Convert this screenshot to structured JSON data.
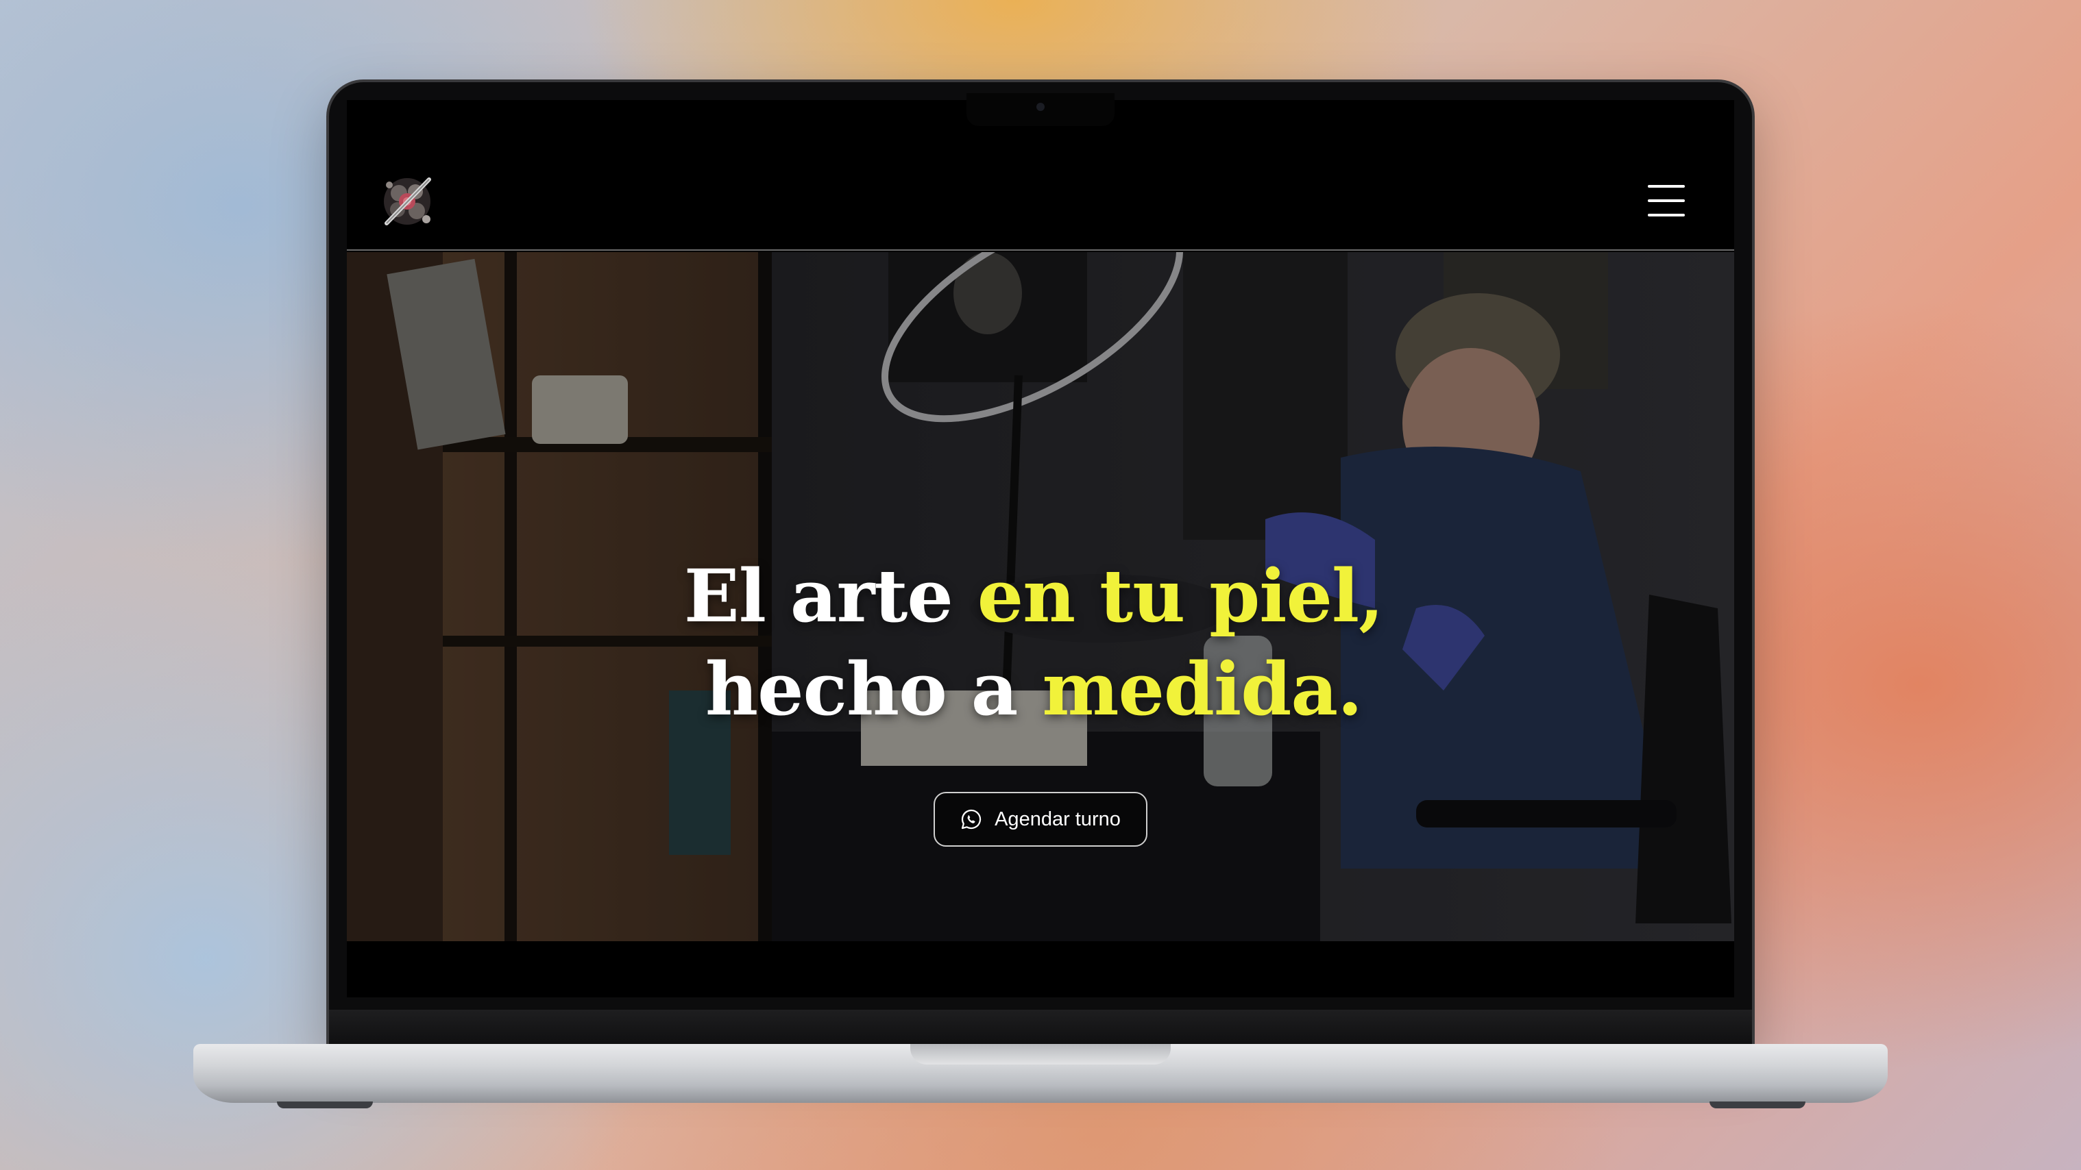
{
  "site": {
    "hero": {
      "headline_line1": {
        "part1": "El arte ",
        "part2": "en tu piel,",
        "part2_color": "#f1f23a"
      },
      "headline_line2": {
        "part1": "hecho a ",
        "part2": "medida.",
        "part2_color": "#f1f23a"
      }
    },
    "cta": {
      "label": "Agendar turno",
      "icon": "whatsapp-icon"
    },
    "header": {
      "logo": "tattoo-logo",
      "menu_icon": "hamburger-menu-icon"
    }
  },
  "colors": {
    "accent": "#f1f23a",
    "text": "#ffffff",
    "background": "#000000"
  }
}
